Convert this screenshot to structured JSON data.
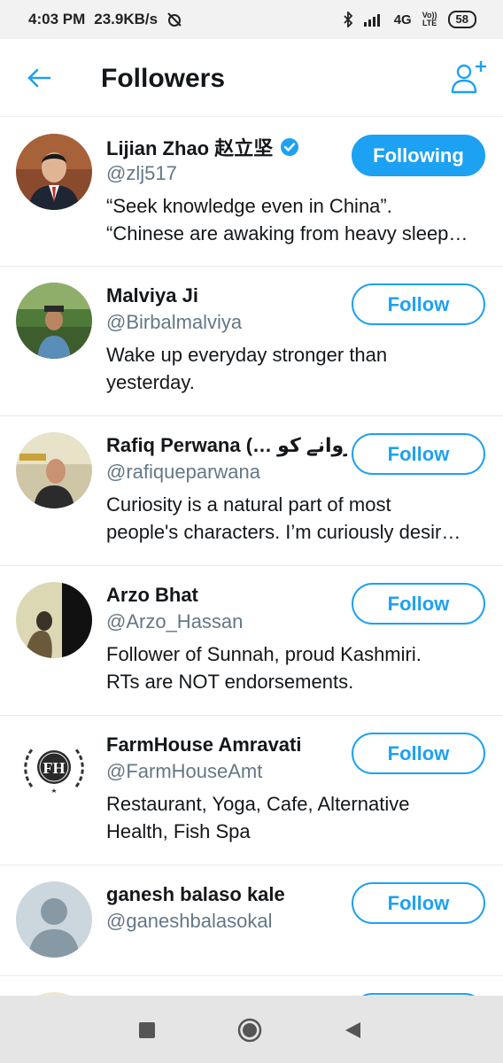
{
  "status_bar": {
    "time": "4:03 PM",
    "speed": "23.9KB/s",
    "network": "4G",
    "volte_top": "Vo))",
    "volte_bottom": "LTE",
    "battery": "58"
  },
  "header": {
    "title": "Followers",
    "back_icon": "arrow-left-icon",
    "add_icon": "add-user-icon"
  },
  "colors": {
    "accent": "#1da1f2",
    "secondary_text": "#657786",
    "divider": "#e6ecf0"
  },
  "followers": [
    {
      "name": "Lijian Zhao 赵立坚",
      "verified": true,
      "handle": "@zlj517",
      "bio": [
        "“Seek knowledge even in China”.",
        "“Chinese are awaking from heavy sleep…"
      ],
      "button": "Following",
      "following": true
    },
    {
      "name": "Malviya Ji",
      "verified": false,
      "handle": "@Birbalmalviya",
      "bio": [
        "Wake up everyday stronger than",
        "yesterday."
      ],
      "button": "Follow",
      "following": false
    },
    {
      "name": "Rafiq Perwana (… پروانے کو",
      "verified": false,
      "handle": "@rafiqueparwana",
      "bio": [
        "Curiosity is a natural part of most",
        "people's characters. I’m curiously desir…"
      ],
      "button": "Follow",
      "following": false
    },
    {
      "name": "Arzo Bhat",
      "verified": false,
      "handle": "@Arzo_Hassan",
      "bio": [
        "Follower of Sunnah, proud Kashmiri.",
        "RTs are NOT endorsements."
      ],
      "button": "Follow",
      "following": false
    },
    {
      "name": "FarmHouse Amravati",
      "verified": false,
      "handle": "@FarmHouseAmt",
      "bio": [
        "Restaurant, Yoga, Cafe, Alternative",
        "Health, Fish Spa"
      ],
      "button": "Follow",
      "following": false
    },
    {
      "name": "ganesh balaso kale",
      "verified": false,
      "handle": "@ganeshbalasokal",
      "bio": [],
      "button": "Follow",
      "following": false
    }
  ],
  "logo_text": "FH"
}
